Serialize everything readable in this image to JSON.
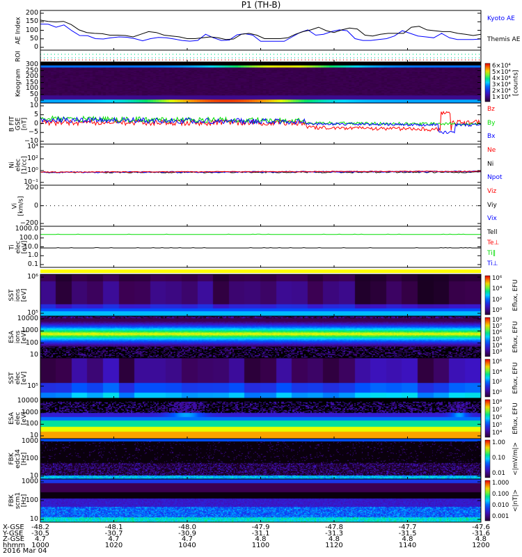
{
  "title": "P1 (TH-B)",
  "colors": {
    "red": "#ff0000",
    "green": "#00dd00",
    "blue": "#0000ff",
    "black": "#000000",
    "yellow": "#ffff00"
  },
  "chart_data": [
    {
      "id": "ae",
      "type": "line",
      "ylabel": "AE Index",
      "ylim": [
        0,
        200
      ],
      "yticks": [
        "200",
        "150",
        "100",
        "50",
        "0"
      ],
      "series": [
        {
          "name": "Kyoto AE",
          "color": "#0000ff",
          "values": [
            133,
            132,
            115,
            128,
            95,
            68,
            67,
            50,
            48,
            55,
            60,
            58,
            50,
            38,
            50,
            57,
            55,
            48,
            40,
            36,
            40,
            75,
            55,
            40,
            42,
            72,
            78,
            70,
            35,
            35,
            35,
            35,
            60,
            85,
            100,
            70,
            75,
            90,
            100,
            95,
            50,
            40,
            40,
            45,
            50,
            65,
            95,
            80,
            65,
            60,
            55,
            80,
            55,
            45,
            45,
            45,
            48
          ]
        },
        {
          "name": "Themis AE",
          "color": "#000000",
          "values": [
            155,
            148,
            145,
            148,
            130,
            100,
            85,
            80,
            78,
            70,
            70,
            68,
            60,
            75,
            90,
            85,
            70,
            65,
            60,
            50,
            50,
            55,
            60,
            55,
            45,
            48,
            75,
            80,
            70,
            50,
            50,
            50,
            55,
            75,
            90,
            100,
            115,
            95,
            85,
            100,
            110,
            105,
            70,
            65,
            75,
            80,
            80,
            80,
            115,
            120,
            100,
            95,
            90,
            90,
            80,
            75,
            68,
            75
          ]
        }
      ]
    },
    {
      "id": "roi",
      "type": "scatter",
      "ylabel": "ROI"
    },
    {
      "id": "keogram",
      "type": "heatmap",
      "ylabel": "Keogram",
      "yticks": [
        "300",
        "250",
        "200",
        "150",
        "100",
        "50",
        "0"
      ],
      "colorbar": [
        "6×10⁴",
        "5×10⁴",
        "4×10⁴",
        "3×10⁴",
        "2×10⁴",
        "1×10⁴"
      ],
      "cbunit": "[counts]"
    },
    {
      "id": "bfit",
      "type": "line",
      "ylabel": "B FIT\nGSE\n[nT]",
      "ylim": [
        -10,
        10
      ],
      "yticks": [
        "10",
        "5",
        "0",
        "−5",
        "−10"
      ],
      "legend": [
        "Bz",
        "By",
        "Bx"
      ]
    },
    {
      "id": "ni",
      "type": "line",
      "ylabel": "Ni\nelec\n[1/cc]",
      "yticks": [
        "10⁴",
        "10²",
        "10⁰",
        "10⁻¹"
      ],
      "legend": [
        "Ne",
        "Ni",
        "Npot"
      ]
    },
    {
      "id": "vi",
      "type": "line",
      "ylabel": "Vi\n[km/s]",
      "ylim": [
        -400,
        400
      ],
      "yticks": [
        "200",
        "0",
        "−200"
      ],
      "legend": [
        "Viz",
        "Viy",
        "Vix"
      ]
    },
    {
      "id": "ti",
      "type": "line",
      "ylabel": "Ti\nelec\n[eV]",
      "yticks": [
        "1000.0",
        "100.0",
        "10.0",
        "1.0",
        "0.1"
      ],
      "legend": [
        "Tell",
        "Te⊥",
        "Ti‖",
        "Ti⊥"
      ]
    },
    {
      "id": "sst_i",
      "type": "heatmap",
      "ylabel": "SST\nions\n[eV]",
      "yticks": [
        "10⁶",
        "10⁵"
      ],
      "colorbar": [
        "10⁶",
        "10⁴",
        "10²",
        "10⁰"
      ],
      "cbunit": "Eflux, EFU"
    },
    {
      "id": "esa_i",
      "type": "heatmap",
      "ylabel": "ESA\nions\n[eV]",
      "yticks": [
        "10000",
        "1000",
        "100",
        "10"
      ],
      "colorbar": [
        "10⁸",
        "10⁷",
        "10⁶",
        "10⁵",
        "10⁴",
        "10³"
      ],
      "cbunit": "Eflux, EFU"
    },
    {
      "id": "sst_e",
      "type": "heatmap",
      "ylabel": "SST\nelec\n[eV]",
      "yticks": [
        "10⁵"
      ],
      "colorbar": [
        "10⁶",
        "10⁴",
        "10²",
        "10⁰"
      ],
      "cbunit": "Eflux, EFU"
    },
    {
      "id": "esa_e",
      "type": "heatmap",
      "ylabel": "ESA\nelec\n[eV]",
      "yticks": [
        "10000",
        "1000",
        "100",
        "10"
      ],
      "colorbar": [
        "10⁸",
        "10⁷",
        "10⁶",
        "10⁵",
        "10⁴"
      ],
      "cbunit": "Eflux, EFU"
    },
    {
      "id": "fbk_e",
      "type": "heatmap",
      "ylabel": "FBK\nedc34\n[Hz]",
      "yticks": [
        "1000",
        "100",
        "10"
      ],
      "colorbar": [
        "1.00",
        "0.10",
        "0.01"
      ],
      "cbunit": "<|mV/m|>"
    },
    {
      "id": "fbk_b",
      "type": "heatmap",
      "ylabel": "FBK\nscm1\n[Hz]",
      "yticks": [
        "1000",
        "100",
        "10"
      ],
      "colorbar": [
        "1.000",
        "0.100",
        "0.010",
        "0.001"
      ],
      "cbunit": "<|nT|>"
    }
  ],
  "xaxis": {
    "row_labels": [
      "X-GSE",
      "Y-GSE",
      "Z-GSE",
      "hhmm"
    ],
    "date": "2016 Mar 04",
    "ticks": [
      {
        "x": "-48.2",
        "y": "-30.5",
        "z": "4.7",
        "t": "1000"
      },
      {
        "x": "-48.1",
        "y": "-30.7",
        "z": "4.7",
        "t": "1020"
      },
      {
        "x": "-48.0",
        "y": "-30.9",
        "z": "4.7",
        "t": "1040"
      },
      {
        "x": "-47.9",
        "y": "-31.1",
        "z": "4.8",
        "t": "1100"
      },
      {
        "x": "-47.8",
        "y": "-31.3",
        "z": "4.8",
        "t": "1120"
      },
      {
        "x": "-47.7",
        "y": "-31.5",
        "z": "4.8",
        "t": "1140"
      },
      {
        "x": "-47.6",
        "y": "-31.6",
        "z": "4.8",
        "t": "1200"
      }
    ]
  }
}
